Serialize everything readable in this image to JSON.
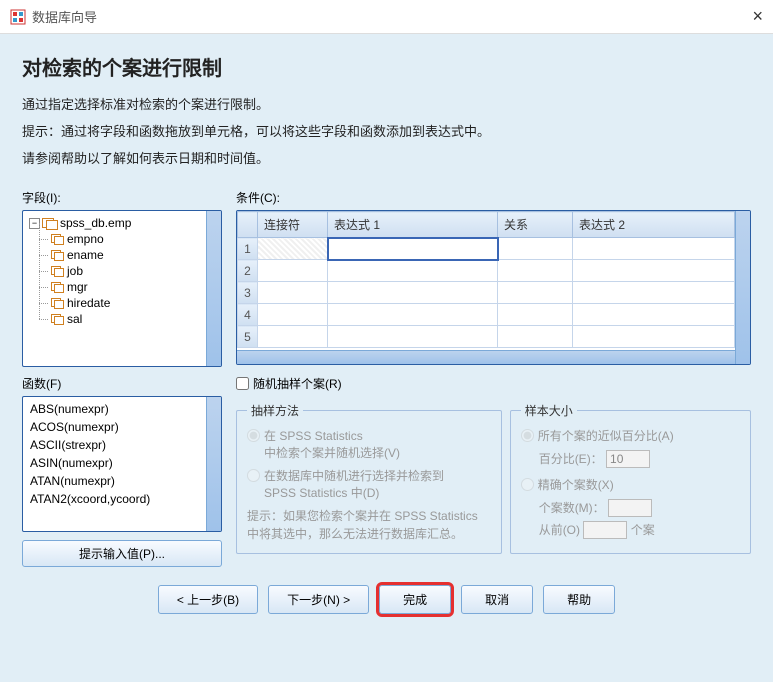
{
  "window": {
    "title": "数据库向导",
    "close": "×"
  },
  "header": {
    "heading": "对检索的个案进行限制",
    "desc1": "通过指定选择标准对检索的个案进行限制。",
    "desc2": "提示：通过将字段和函数拖放到单元格，可以将这些字段和函数添加到表达式中。",
    "desc3": "请参阅帮助以了解如何表示日期和时间值。"
  },
  "labels": {
    "fields": "字段(I):",
    "functions": "函数(F)",
    "conditions": "条件(C):",
    "prompt_btn": "提示输入值(P)...",
    "random_check": "随机抽样个案(R)"
  },
  "tree": {
    "root": "spss_db.emp",
    "children": [
      "empno",
      "ename",
      "job",
      "mgr",
      "hiredate",
      "sal"
    ]
  },
  "functions": [
    "ABS(numexpr)",
    "ACOS(numexpr)",
    "ASCII(strexpr)",
    "ASIN(numexpr)",
    "ATAN(numexpr)",
    "ATAN2(xcoord,ycoord)"
  ],
  "grid": {
    "headers": {
      "conn": "连接符",
      "expr1": "表达式 1",
      "rel": "关系",
      "expr2": "表达式 2"
    },
    "rows": [
      1,
      2,
      3,
      4,
      5
    ]
  },
  "sampling": {
    "legend": "抽样方法",
    "opt1a": "在 SPSS Statistics",
    "opt1b": "中检索个案并随机选择(V)",
    "opt2a": "在数据库中随机进行选择并检索到",
    "opt2b": "SPSS Statistics 中(D)",
    "hint": "提示：如果您检索个案并在 SPSS Statistics 中将其选中，那么无法进行数据库汇总。"
  },
  "sample_size": {
    "legend": "样本大小",
    "opt1": "所有个案的近似百分比(A)",
    "pct_label": "百分比(E)：",
    "pct_value": "10",
    "opt2": "精确个案数(X)",
    "exact_label": "个案数(M)：",
    "from_label": "从前(O)",
    "from_suffix": "个案"
  },
  "buttons": {
    "back": "< 上一步(B)",
    "next": "下一步(N) >",
    "finish": "完成",
    "cancel": "取消",
    "help": "帮助"
  }
}
